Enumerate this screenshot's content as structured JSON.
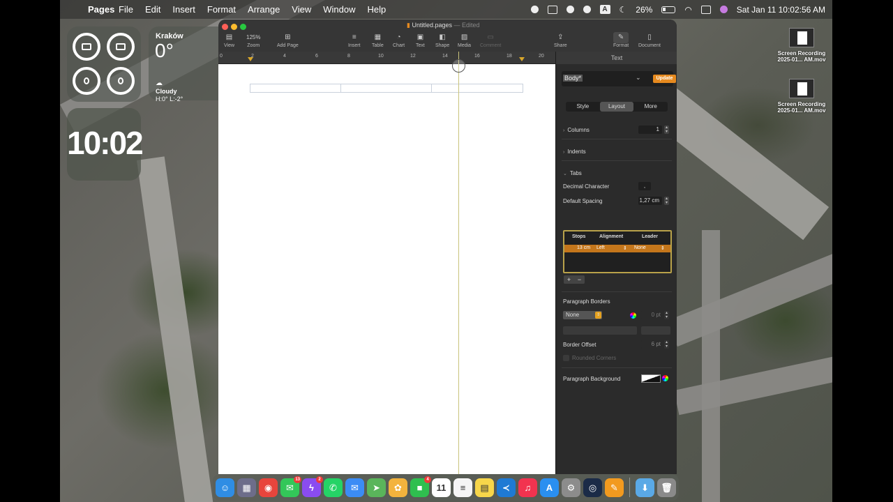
{
  "menubar": {
    "app_name": "Pages",
    "items": [
      "File",
      "Edit",
      "Insert",
      "Format",
      "Arrange",
      "View",
      "Window",
      "Help"
    ],
    "battery": "26%",
    "datetime": "Sat Jan 11  10:02:56 AM",
    "input_badge": "A"
  },
  "widgets": {
    "weather_city": "Kraków",
    "weather_temp": "0°",
    "weather_condition": "Cloudy",
    "weather_range": "H:0° L:-2°",
    "clock": "10:02"
  },
  "window": {
    "title": "Untitled.pages",
    "edited": "— Edited",
    "toolbar": [
      "View",
      "Zoom",
      "Add Page",
      "Insert",
      "Table",
      "Chart",
      "Text",
      "Shape",
      "Media",
      "Comment",
      "Share",
      "Format",
      "Document"
    ],
    "zoom_value": "125%",
    "ruler_labels": [
      "0",
      "2",
      "4",
      "6",
      "8",
      "10",
      "12",
      "14",
      "16",
      "18",
      "20"
    ]
  },
  "inspector": {
    "header": "Text",
    "style_name": "Body*",
    "update_button": "Update",
    "tabs": [
      "Style",
      "Layout",
      "More"
    ],
    "active_tab": "Layout",
    "columns_label": "Columns",
    "columns_value": "1",
    "indents_label": "Indents",
    "tabs_label": "Tabs",
    "decimal_char_label": "Decimal Character",
    "decimal_char_value": ",",
    "default_spacing_label": "Default Spacing",
    "default_spacing_value": "1,27 cm",
    "tab_table_headers": [
      "Stops",
      "Alignment",
      "Leader"
    ],
    "tab_stop": {
      "stop": "13 cm",
      "alignment": "Left",
      "leader": "None"
    },
    "add_label": "+",
    "remove_label": "−",
    "paragraph_borders_label": "Paragraph Borders",
    "border_style": "None",
    "border_width": "0 pt",
    "border_offset_label": "Border Offset",
    "border_offset_value": "6 pt",
    "rounded_corners_label": "Rounded Corners",
    "paragraph_background_label": "Paragraph Background"
  },
  "desktop_icons": [
    {
      "line1": "Screen Recording",
      "line2": "2025-01... AM.mov"
    },
    {
      "line1": "Screen Recording",
      "line2": "2025-01... AM.mov"
    }
  ],
  "dock": {
    "apps": [
      {
        "name": "finder-icon",
        "color": "#2f8de4",
        "glyph": "☺",
        "badge": ""
      },
      {
        "name": "launchpad-icon",
        "color": "#6d6d8a",
        "glyph": "▦",
        "badge": ""
      },
      {
        "name": "chrome-icon",
        "color": "#e8453c",
        "glyph": "◉",
        "badge": ""
      },
      {
        "name": "messages-icon",
        "color": "#33c759",
        "glyph": "✉",
        "badge": "13"
      },
      {
        "name": "messenger-icon",
        "color": "#8a4cf0",
        "glyph": "ϟ",
        "badge": "2"
      },
      {
        "name": "whatsapp-icon",
        "color": "#25d366",
        "glyph": "✆",
        "badge": ""
      },
      {
        "name": "mail-icon",
        "color": "#3b8cf5",
        "glyph": "✉",
        "badge": ""
      },
      {
        "name": "maps-icon",
        "color": "#5ab55b",
        "glyph": "➤",
        "badge": ""
      },
      {
        "name": "photos-icon",
        "color": "#f3b33d",
        "glyph": "✿",
        "badge": ""
      },
      {
        "name": "facetime-icon",
        "color": "#2fbf4f",
        "glyph": "■",
        "badge": "4"
      },
      {
        "name": "calendar-icon",
        "color": "#ffffff",
        "glyph": "11",
        "badge": ""
      },
      {
        "name": "reminders-icon",
        "color": "#f5f5f5",
        "glyph": "≡",
        "badge": ""
      },
      {
        "name": "notes-icon",
        "color": "#f7d64a",
        "glyph": "▤",
        "badge": ""
      },
      {
        "name": "vscode-icon",
        "color": "#1f7ad4",
        "glyph": "≺",
        "badge": ""
      },
      {
        "name": "music-icon",
        "color": "#f2334f",
        "glyph": "♫",
        "badge": ""
      },
      {
        "name": "appstore-icon",
        "color": "#2a8ff0",
        "glyph": "A",
        "badge": ""
      },
      {
        "name": "settings-icon",
        "color": "#8c8c8c",
        "glyph": "⚙",
        "badge": ""
      },
      {
        "name": "steam-icon",
        "color": "#1b2b47",
        "glyph": "◎",
        "badge": ""
      },
      {
        "name": "pages-icon",
        "color": "#f29a1f",
        "glyph": "✎",
        "badge": ""
      }
    ],
    "right": [
      {
        "name": "downloads-folder-icon",
        "color": "#5aa9e6",
        "glyph": "⬇"
      },
      {
        "name": "trash-icon",
        "color": "#8a8a8a",
        "glyph": "🗑"
      }
    ]
  }
}
